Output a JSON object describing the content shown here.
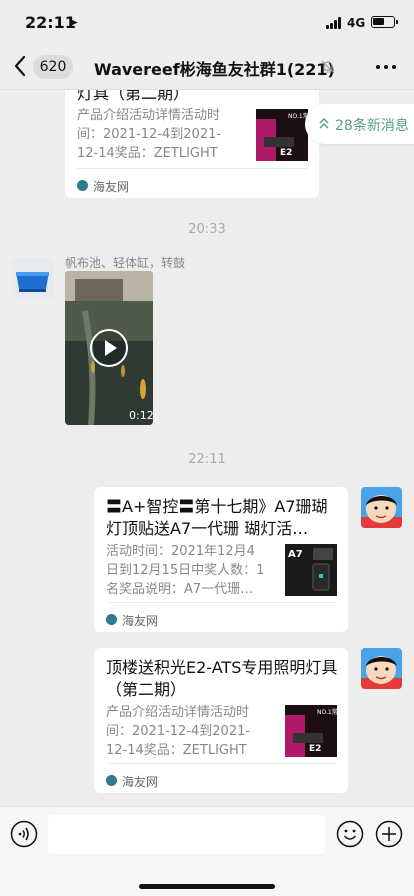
{
  "status_bar": {
    "time": "22:11",
    "network": "4G",
    "battery_level": 0.6
  },
  "nav": {
    "unread_count": "620",
    "title": "Wavereef彬海鱼友社群1(221)"
  },
  "new_messages": {
    "label": "28条新消息"
  },
  "messages": [
    {
      "title": "灯具（第二期）",
      "desc": "产品介绍活动详情活动时间：2021-12-4到2021-12-14奖品：ZETLIGHT积…",
      "thumb_text": "NO.1常量 50ㄧ不要钱",
      "thumb_model": "E2",
      "source": "海友网"
    },
    {
      "time": "20:33"
    },
    {
      "sender": "帆布池、轻体缸，转鼓",
      "video_duration": "0:12"
    },
    {
      "time": "22:11"
    },
    {
      "title": "〓A+智控〓第十七期》A7珊瑚灯顶贴送A7一代珊 瑚灯活…",
      "desc": "活动时间：2021年12月4日到12月15日中奖人数：1名奖品说明：A7一代珊…",
      "thumb_model": "A7",
      "source": "海友网"
    },
    {
      "title": "顶楼送积光E2-ATS专用照明灯具（第二期）",
      "desc": "产品介绍活动详情活动时间：2021-12-4到2021-12-14奖品：ZETLIGHT积…",
      "thumb_text": "NO.1常量 50ㄧ不要钱",
      "thumb_model": "E2",
      "source": "海友网"
    }
  ],
  "input_bar": {
    "placeholder": ""
  }
}
